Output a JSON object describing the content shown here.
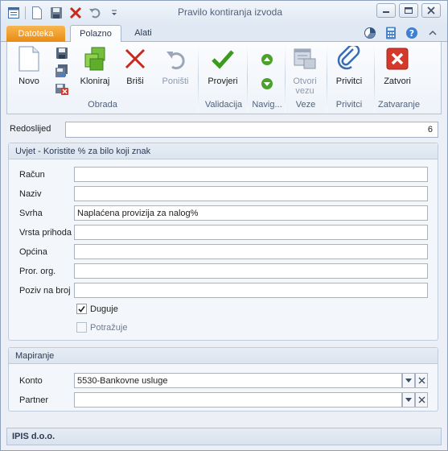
{
  "window": {
    "title": "Pravilo kontiranja izvoda"
  },
  "tabs": {
    "file": "Datoteka",
    "home": "Polazno",
    "tools": "Alati"
  },
  "ribbon": {
    "new": "Novo",
    "clone": "Kloniraj",
    "delete": "Briši",
    "undo": "Poništi",
    "check": "Provjeri",
    "open_link_1": "Otvori",
    "open_link_2": "vezu",
    "attachments": "Privitci",
    "close": "Zatvori",
    "groups": {
      "edit": "Obrada",
      "validation": "Validacija",
      "navigation": "Navig...",
      "links": "Veze",
      "attachments": "Privitci",
      "close": "Zatvaranje"
    }
  },
  "form": {
    "order_label": "Redoslijed",
    "order_value": "6",
    "condition_title": "Uvjet - Koristite % za bilo koji znak",
    "fields": {
      "account_label": "Račun",
      "account_value": "",
      "name_label": "Naziv",
      "name_value": "",
      "purpose_label": "Svrha",
      "purpose_value": "Naplaćena provizija za nalog%",
      "income_type_label": "Vrsta prihoda",
      "income_type_value": "",
      "municipality_label": "Općina",
      "municipality_value": "",
      "org_label": "Pror. org.",
      "org_value": "",
      "reference_label": "Poziv na broj",
      "reference_value": ""
    },
    "debit_label": "Duguje",
    "debit_checked": true,
    "credit_label": "Potražuje",
    "credit_checked": false,
    "mapping_title": "Mapiranje",
    "konto_label": "Konto",
    "konto_value": "5530-Bankovne usluge",
    "partner_label": "Partner",
    "partner_value": ""
  },
  "status": {
    "company": "IPIS d.o.o."
  },
  "colors": {
    "file_tab": "#e98b13",
    "check_green": "#3c9a1f",
    "close_red": "#d33a2c"
  }
}
